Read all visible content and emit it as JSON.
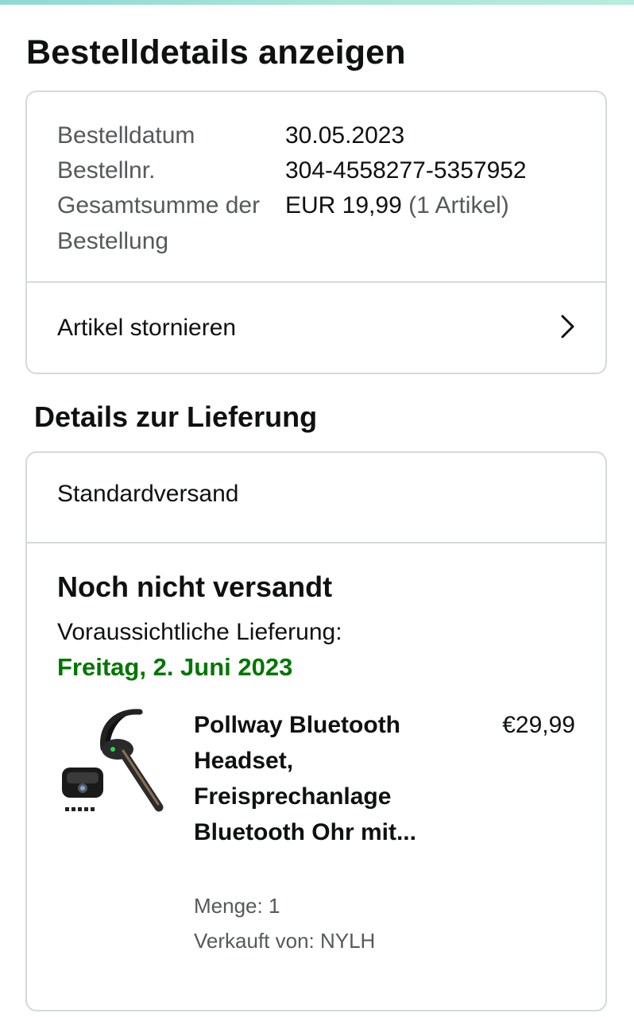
{
  "page": {
    "title": "Bestelldetails anzeigen"
  },
  "order": {
    "rows": [
      {
        "label": "Bestelldatum",
        "value": "30.05.2023"
      },
      {
        "label": "Bestellnr.",
        "value": "304-4558277-5357952"
      },
      {
        "label": "Gesamtsumme der Bestellung",
        "value": "EUR 19,99",
        "value_note": "(1 Artikel)"
      }
    ],
    "cancel_label": "Artikel stornieren"
  },
  "delivery": {
    "section_title": "Details zur Lieferung",
    "shipping_method": "Standardversand",
    "status": "Noch nicht versandt",
    "eta_label": "Voraussichtliche Lieferung:",
    "eta_date": "Freitag, 2. Juni 2023",
    "eta_color": "#007600"
  },
  "product": {
    "title": "Pollway Bluetooth Headset, Freisprechanlage Bluetooth Ohr mit...",
    "price": "€29,99",
    "quantity": "Menge: 1",
    "seller": "Verkauft von: NYLH",
    "image_icon": "bluetooth-headset-product-image"
  },
  "icons": {
    "cancel_chevron": "chevron-right-icon"
  }
}
